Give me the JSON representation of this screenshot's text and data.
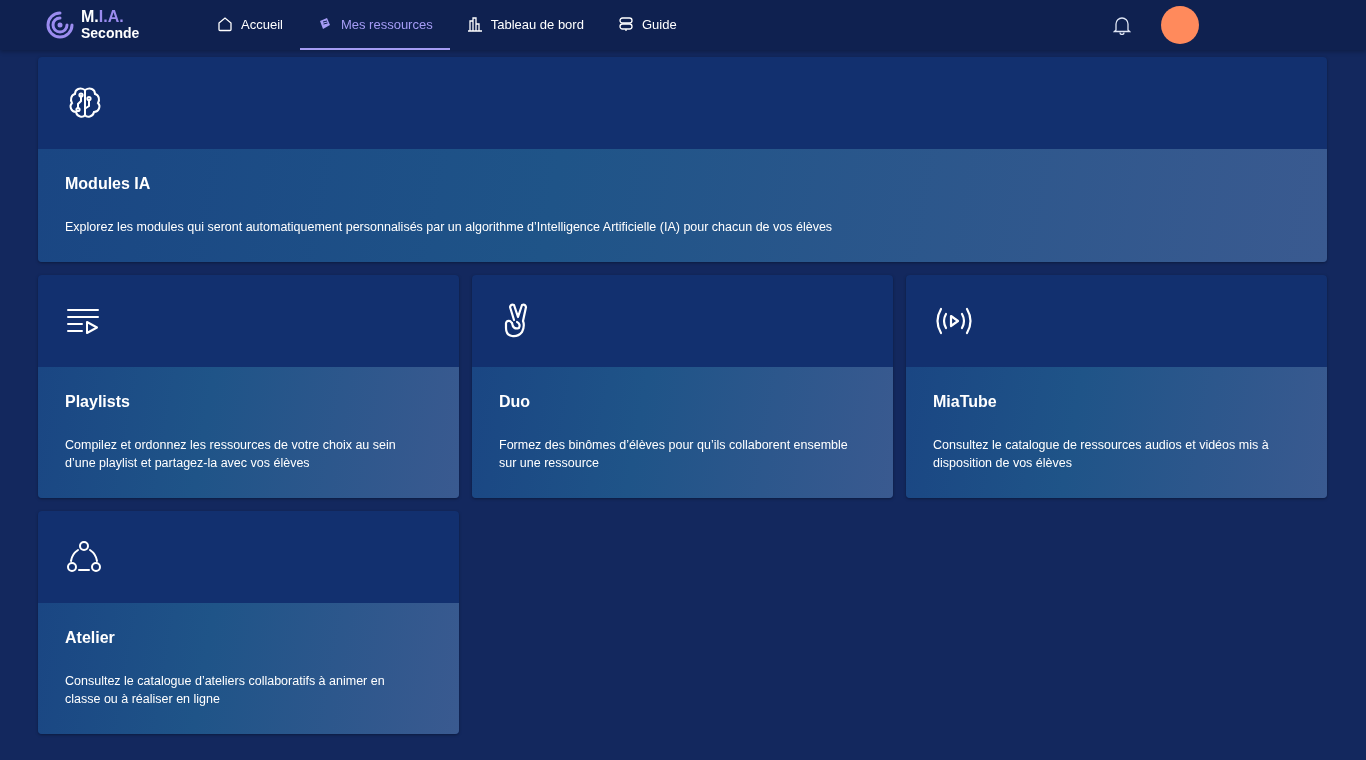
{
  "logo": {
    "prefix": "M.",
    "accent": "I.A.",
    "subtitle": "Seconde"
  },
  "nav": [
    {
      "label": "Accueil",
      "kind": "home",
      "selected": false
    },
    {
      "label": "Mes ressources",
      "kind": "resources",
      "selected": true
    },
    {
      "label": "Tableau de bord",
      "kind": "chart",
      "selected": false
    },
    {
      "label": "Guide",
      "kind": "guide",
      "selected": false
    }
  ],
  "cards": [
    {
      "kind": "brain",
      "title": "Modules IA",
      "description": "Explorez les modules qui seront automatiquement personnalisés par un algorithme d’Intelligence Artificielle (IA) pour chacun de vos élèves"
    },
    {
      "kind": "playlist",
      "title": "Playlists",
      "description": "Compilez et ordonnez les ressources de votre choix au sein d’une playlist et partagez-la avec vos élèves"
    },
    {
      "kind": "peace",
      "title": "Duo",
      "description": "Formez des binômes d’élèves pour qu’ils collaborent ensemble sur une ressource"
    },
    {
      "kind": "broadcast",
      "title": "MiaTube",
      "description": "Consultez le catalogue de ressources audios et vidéos mis à disposition de vos élèves"
    },
    {
      "kind": "workshop",
      "title": "Atelier",
      "description": "Consultez le catalogue d’ateliers collaboratifs à animer en classe ou à réaliser en ligne"
    }
  ]
}
